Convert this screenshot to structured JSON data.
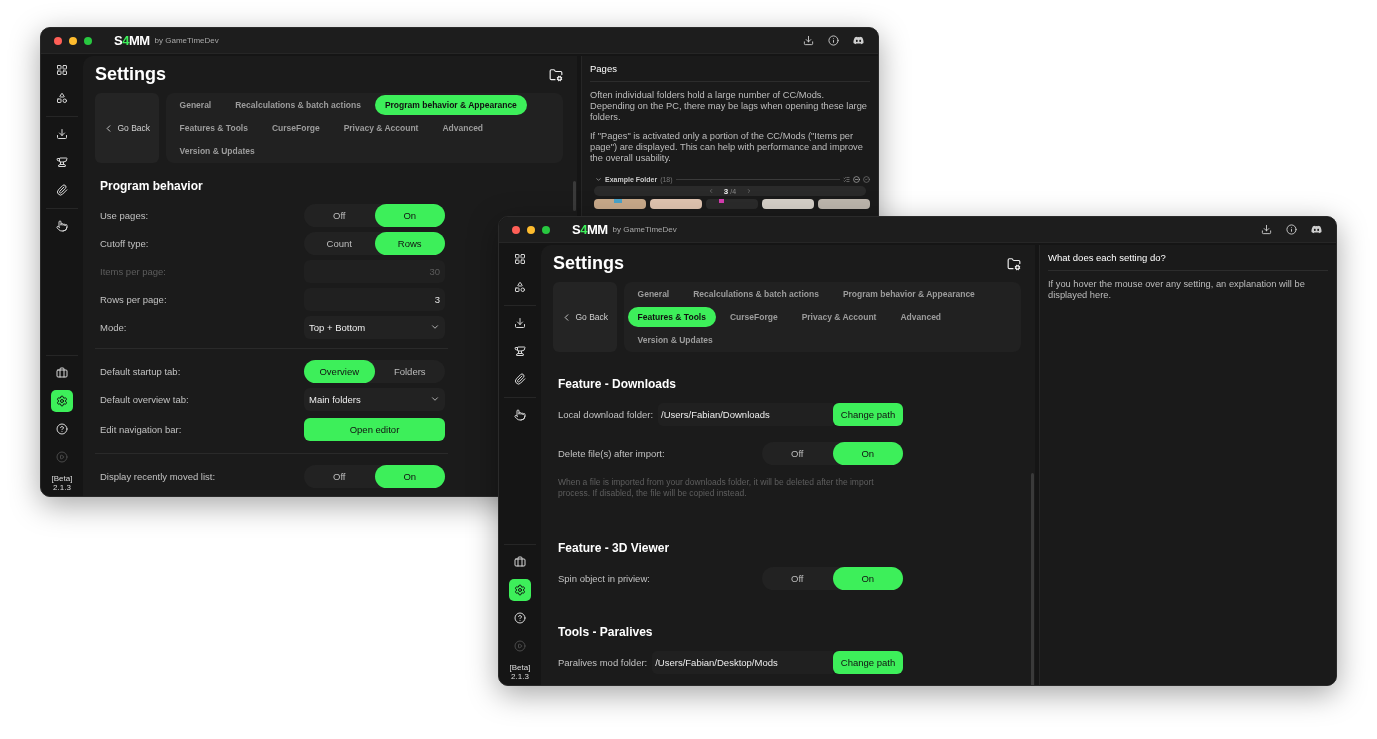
{
  "windows": [
    {
      "title_bar": {
        "logo": [
          {
            "text": "S",
            "accent": false
          },
          {
            "text": "4",
            "accent": true
          },
          {
            "text": "MM",
            "accent": false
          }
        ],
        "byline": "by GameTimeDev"
      },
      "sidebar": {
        "top_groups": [
          [
            {
              "selected": false
            },
            {
              "selected": false
            }
          ],
          [
            {
              "selected": false
            },
            {
              "selected": false
            },
            {
              "selected": false
            }
          ],
          [
            {
              "selected": false
            }
          ]
        ],
        "bottom_items": [
          {
            "selected": false,
            "disabled": false
          },
          {
            "selected": true,
            "disabled": false
          },
          {
            "selected": false,
            "disabled": false
          },
          {
            "selected": false,
            "disabled": true
          }
        ],
        "beta": "[Beta]",
        "version": "2.1.3"
      },
      "main": {
        "title": "Settings",
        "go_back": "Go Back",
        "tabs": [
          {
            "label": "General",
            "selected": false
          },
          {
            "label": "Recalculations & batch actions",
            "selected": false
          },
          {
            "label": "Program behavior & Appearance",
            "selected": true
          },
          {
            "label": "Features & Tools",
            "selected": false
          },
          {
            "label": "CurseForge",
            "selected": false
          },
          {
            "label": "Privacy & Account",
            "selected": false
          },
          {
            "label": "Advanced",
            "selected": false
          },
          {
            "label": "Version & Updates",
            "selected": false
          }
        ],
        "sections": [
          {
            "heading": "Program behavior",
            "groups": [
              [
                {
                  "kind": "toggle",
                  "label": "Use pages:",
                  "options": [
                    {
                      "label": "Off",
                      "selected": false
                    },
                    {
                      "label": "On",
                      "selected": true
                    }
                  ]
                },
                {
                  "kind": "toggle",
                  "label": "Cutoff type:",
                  "options": [
                    {
                      "label": "Count",
                      "selected": false
                    },
                    {
                      "label": "Rows",
                      "selected": true
                    }
                  ]
                },
                {
                  "kind": "number",
                  "label": "Items per page:",
                  "value": "30",
                  "disabled": true
                },
                {
                  "kind": "number",
                  "label": "Rows per page:",
                  "value": "3",
                  "disabled": false
                },
                {
                  "kind": "select",
                  "label": "Mode:",
                  "value": "Top + Bottom"
                }
              ],
              [
                {
                  "kind": "toggle",
                  "label": "Default startup tab:",
                  "options": [
                    {
                      "label": "Overview",
                      "selected": true
                    },
                    {
                      "label": "Folders",
                      "selected": false
                    }
                  ]
                },
                {
                  "kind": "select",
                  "label": "Default overview tab:",
                  "value": "Main folders"
                },
                {
                  "kind": "button",
                  "label": "Edit navigation bar:",
                  "action": "Open editor"
                }
              ],
              [
                {
                  "kind": "toggle",
                  "label": "Display recently moved list:",
                  "options": [
                    {
                      "label": "Off",
                      "selected": false
                    },
                    {
                      "label": "On",
                      "selected": true
                    }
                  ]
                }
              ]
            ]
          }
        ]
      },
      "side_panel": {
        "heading": "Pages",
        "paragraphs": [
          "Often individual folders hold a large number of CC/Mods. Depending on the PC, there may be lags when opening these large folders.",
          "If \"Pages\" is activated only a portion of the CC/Mods (\"Items per page\") are displayed. This can help with performance and improve the overall usability."
        ],
        "example": {
          "folder": "Example Folder",
          "count": "(18)",
          "page": "3",
          "total": "/4"
        }
      }
    },
    {
      "title_bar": {
        "logo": [
          {
            "text": "S",
            "accent": false
          },
          {
            "text": "4",
            "accent": true
          },
          {
            "text": "MM",
            "accent": false
          }
        ],
        "byline": "by GameTimeDev"
      },
      "sidebar": {
        "top_groups": [
          [
            {
              "selected": false
            },
            {
              "selected": false
            }
          ],
          [
            {
              "selected": false
            },
            {
              "selected": false
            },
            {
              "selected": false
            }
          ],
          [
            {
              "selected": false
            }
          ]
        ],
        "bottom_items": [
          {
            "selected": false,
            "disabled": false
          },
          {
            "selected": true,
            "disabled": false
          },
          {
            "selected": false,
            "disabled": false
          },
          {
            "selected": false,
            "disabled": true
          }
        ],
        "beta": "[Beta]",
        "version": "2.1.3"
      },
      "main": {
        "title": "Settings",
        "go_back": "Go Back",
        "tabs": [
          {
            "label": "General",
            "selected": false
          },
          {
            "label": "Recalculations & batch actions",
            "selected": false
          },
          {
            "label": "Program behavior & Appearance",
            "selected": false
          },
          {
            "label": "Features & Tools",
            "selected": true
          },
          {
            "label": "CurseForge",
            "selected": false
          },
          {
            "label": "Privacy & Account",
            "selected": false
          },
          {
            "label": "Advanced",
            "selected": false
          },
          {
            "label": "Version & Updates",
            "selected": false
          }
        ],
        "sections": [
          {
            "heading": "Feature - Downloads",
            "groups": [
              [
                {
                  "kind": "path",
                  "label": "Local download folder:",
                  "value": "/Users/Fabian/Downloads",
                  "action": "Change path"
                },
                {
                  "kind": "toggle",
                  "label": "Delete file(s) after import:",
                  "options": [
                    {
                      "label": "Off",
                      "selected": false
                    },
                    {
                      "label": "On",
                      "selected": true
                    }
                  ]
                },
                {
                  "kind": "note",
                  "text": "When a file is imported from your downloads folder, it will be deleted after the import process. If disabled, the file will be copied instead."
                }
              ]
            ]
          },
          {
            "heading": "Feature - 3D Viewer",
            "groups": [
              [
                {
                  "kind": "toggle",
                  "label": "Spin object in priview:",
                  "options": [
                    {
                      "label": "Off",
                      "selected": false
                    },
                    {
                      "label": "On",
                      "selected": true
                    }
                  ]
                }
              ]
            ]
          },
          {
            "heading": "Tools - Paralives",
            "groups": [
              [
                {
                  "kind": "path",
                  "label": "Paralives mod folder:",
                  "value": "/Users/Fabian/Desktop/Mods",
                  "action": "Change path"
                }
              ]
            ]
          }
        ]
      },
      "side_panel": {
        "heading": "What does each setting do?",
        "paragraphs": [
          "If you hover the mouse over any setting, an explanation will be displayed here."
        ]
      }
    }
  ]
}
